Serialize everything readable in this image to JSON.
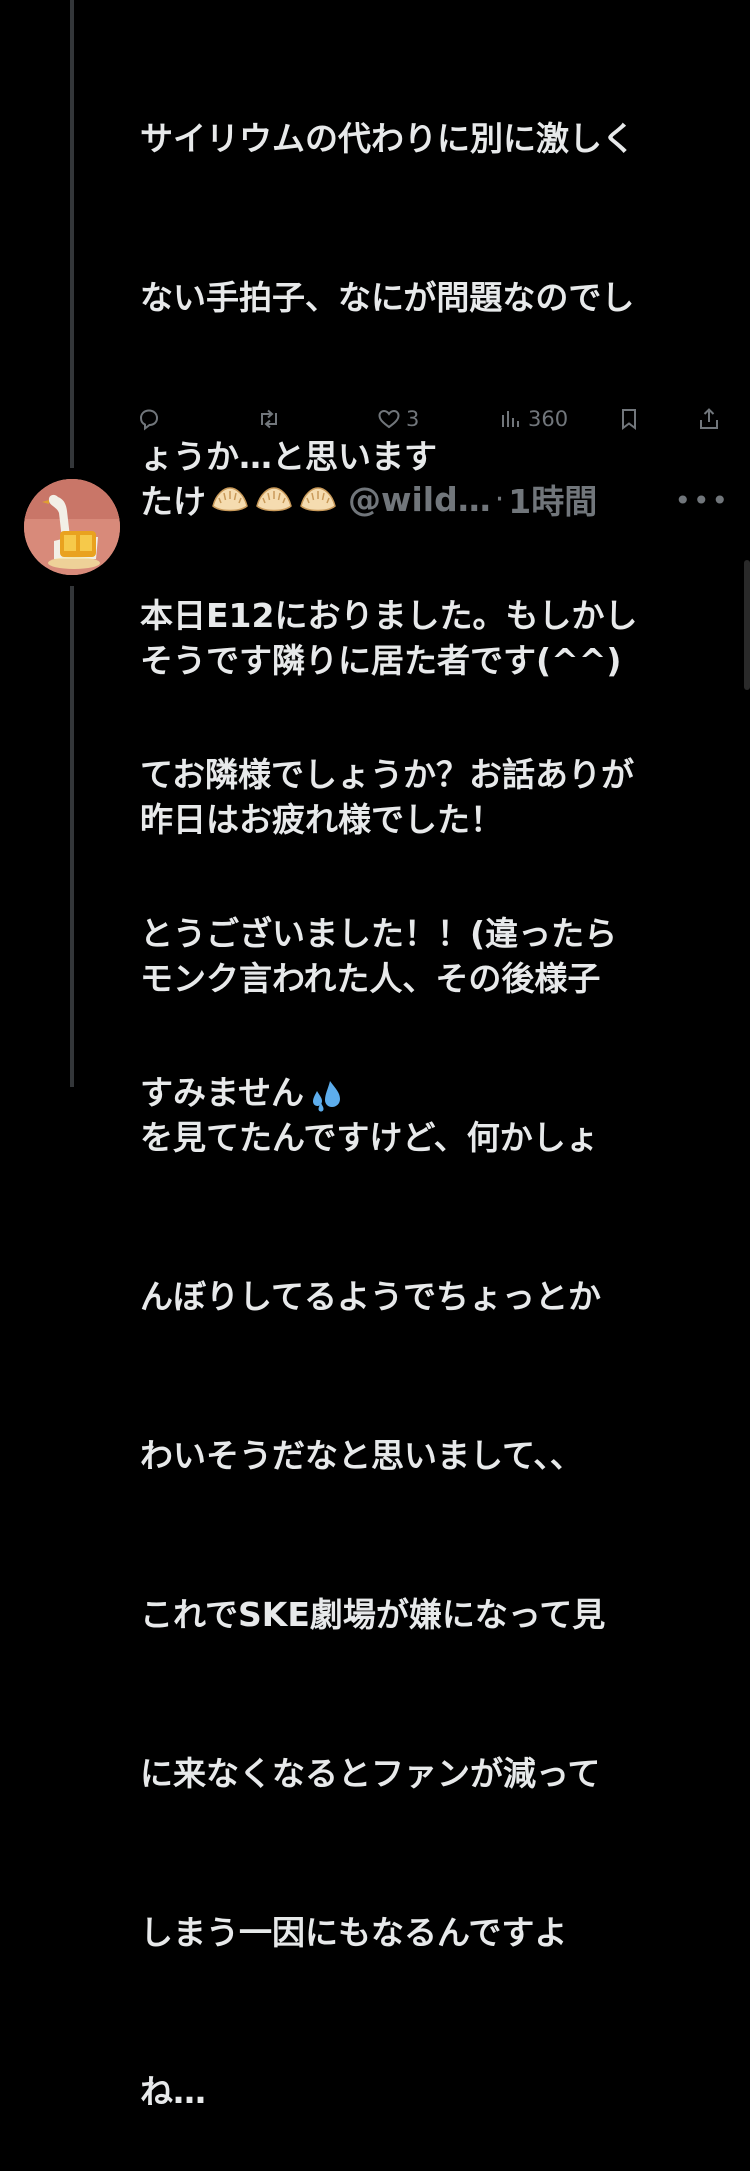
{
  "tweet1": {
    "lines": [
      "サイリウムの代わりに別に激しく",
      "ない手拍子、なにが問題なのでし",
      "ょうか…と思います",
      "本日E12におりました。もしかし",
      "てお隣様でしょうか？お話ありが",
      "とうございました！！(違ったら",
      "すみません"
    ],
    "end_emoji": "sweat-droplets",
    "actions": {
      "reply_count": "",
      "retweet_count": "",
      "like_count": "3",
      "view_count": "360"
    }
  },
  "tweet2": {
    "author_name": "たけ",
    "name_emojis": [
      "dumpling",
      "dumpling",
      "dumpling"
    ],
    "handle": "@wild…",
    "separator": "·",
    "time": "1時間",
    "more_label": "•••",
    "lines": [
      "そうです隣りに居た者です(^^)",
      "昨日はお疲れ様でした！",
      "モンク言われた人、その後様子",
      "を見てたんですけど、何かしょ",
      "んぼりしてるようでちょっとか",
      "わいそうだなと思いまして、、",
      "これでSKE劇場が嫌になって見",
      "に来なくなるとファンが減って",
      "しまう一因にもなるんですよ",
      "ね…"
    ]
  },
  "colors": {
    "background": "#000000",
    "text": "#e7e9ea",
    "muted": "#71767b",
    "thread_line": "#333639"
  }
}
